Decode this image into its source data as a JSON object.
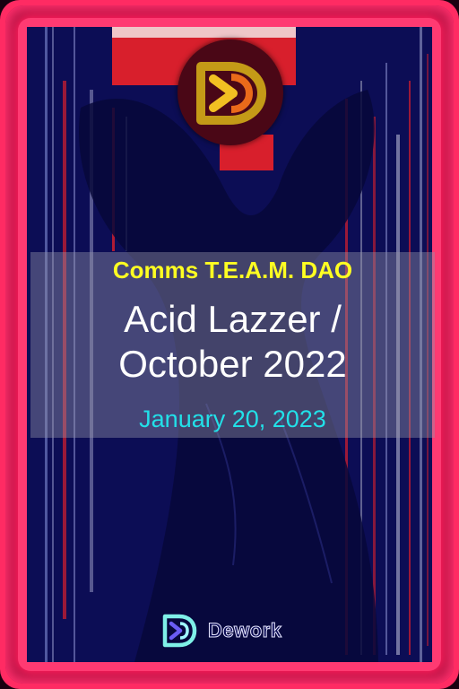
{
  "colors": {
    "frame": "#ff2b63",
    "frame_dark": "#a4123f",
    "artwork_background": "#0c0d55",
    "dao_name_color": "#ffff22",
    "title_color": "#ffffff",
    "date_color": "#22e0e8"
  },
  "logo": {
    "icon": "dework-d-logo-icon"
  },
  "card": {
    "dao_name": "Comms T.E.A.M. DAO",
    "title_line1": "Acid Lazzer /",
    "title_line2": "October 2022",
    "date": "January 20, 2023"
  },
  "footer": {
    "icon": "dework-logo-icon",
    "brand_name": "Dework"
  }
}
